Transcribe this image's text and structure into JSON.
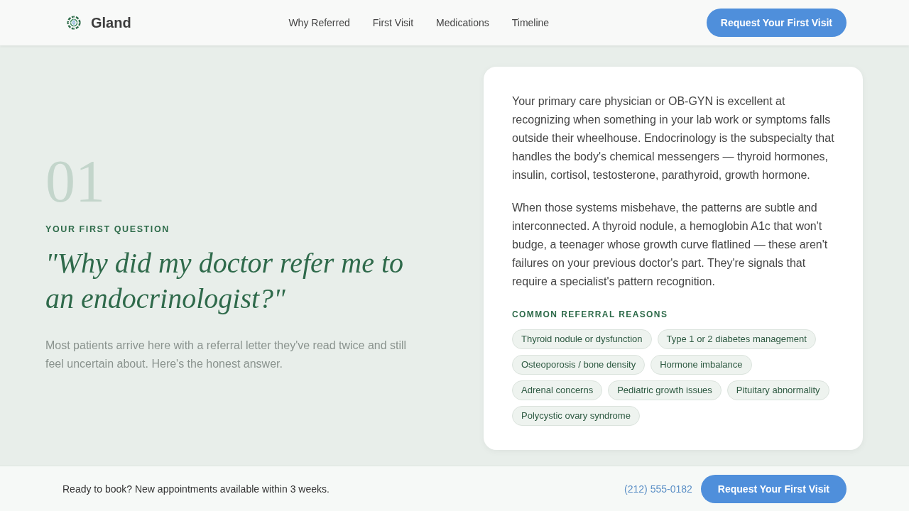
{
  "header": {
    "brand": "Gland",
    "nav": [
      {
        "label": "Why Referred"
      },
      {
        "label": "First Visit"
      },
      {
        "label": "Medications"
      },
      {
        "label": "Timeline"
      }
    ],
    "cta": "Request Your First Visit"
  },
  "hero": {
    "number": "01",
    "eyebrow": "YOUR FIRST QUESTION",
    "heading": "\"Why did my doctor refer me to an endocrinologist?\"",
    "intro": "Most patients arrive here with a referral letter they've read twice and still feel uncertain about. Here's the honest answer."
  },
  "card": {
    "paragraphs": [
      "Your primary care physician or OB-GYN is excellent at recognizing when something in your lab work or symptoms falls outside their wheelhouse. Endocrinology is the subspecialty that handles the body's chemical messengers — thyroid hormones, insulin, cortisol, testosterone, parathyroid, growth hormone.",
      "When those systems misbehave, the patterns are subtle and interconnected. A thyroid nodule, a hemoglobin A1c that won't budge, a teenager whose growth curve flatlined — these aren't failures on your previous doctor's part. They're signals that require a specialist's pattern recognition."
    ],
    "reasons_title": "COMMON REFERRAL REASONS",
    "reasons": [
      "Thyroid nodule or dysfunction",
      "Type 1 or 2 diabetes management",
      "Osteoporosis / bone density",
      "Hormone imbalance",
      "Adrenal concerns",
      "Pediatric growth issues",
      "Pituitary abnormality",
      "Polycystic ovary syndrome"
    ]
  },
  "footer": {
    "message": "Ready to book? New appointments available within 3 weeks.",
    "phone": "(212) 555-0182",
    "cta": "Request Your First Visit"
  }
}
